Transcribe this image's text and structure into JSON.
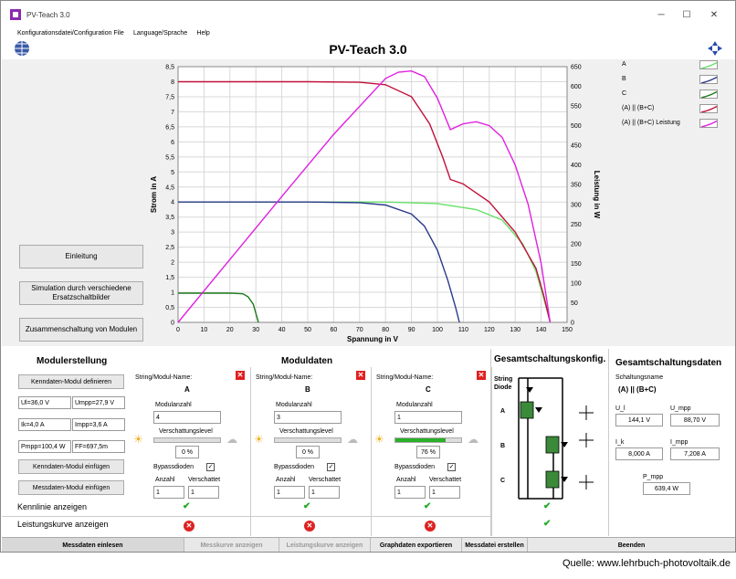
{
  "window": {
    "title": "PV-Teach 3.0",
    "min": "─",
    "max": "☐",
    "close": "✕"
  },
  "menu": [
    "Konfigurationsdatei/Configuration File",
    "Language/Sprache",
    "Help"
  ],
  "app_title": "PV-Teach 3.0",
  "left_buttons": [
    "Einleitung",
    "Simulation durch verschiedene Ersatzschaltbilder",
    "Zusammenschaltung von Modulen"
  ],
  "chart_data": {
    "type": "line",
    "xlabel": "Spannung in V",
    "ylabel": "Strom in A",
    "y2label": "Leistung in W",
    "xticks": [
      0,
      10,
      20,
      30,
      40,
      50,
      60,
      70,
      80,
      90,
      100,
      110,
      120,
      130,
      140,
      150
    ],
    "yticks": [
      "0",
      "0,5",
      "1",
      "1,5",
      "2",
      "2,5",
      "3",
      "3,5",
      "4",
      "4,5",
      "5",
      "5,5",
      "6",
      "6,5",
      "7",
      "7,5",
      "8",
      "8,5"
    ],
    "y2ticks": [
      0,
      50,
      100,
      150,
      200,
      250,
      300,
      350,
      400,
      450,
      500,
      550,
      600,
      650
    ],
    "xlim": [
      0,
      150
    ],
    "ylim": [
      0,
      8.5
    ],
    "y2lim": [
      0,
      650
    ],
    "series": [
      {
        "name": "A",
        "axis": "left",
        "color": "#66e066",
        "x": [
          0,
          40,
          80,
          100,
          115,
          125,
          133,
          138,
          141,
          143.5
        ],
        "y": [
          4,
          4,
          4,
          3.95,
          3.75,
          3.4,
          2.6,
          1.7,
          0.8,
          0
        ]
      },
      {
        "name": "B",
        "axis": "left",
        "color": "#2a3a8a",
        "x": [
          0,
          50,
          70,
          80,
          90,
          95,
          100,
          104,
          107,
          108.5
        ],
        "y": [
          4,
          4,
          3.98,
          3.9,
          3.6,
          3.2,
          2.4,
          1.4,
          0.5,
          0
        ]
      },
      {
        "name": "C",
        "axis": "left",
        "color": "#1a7a1a",
        "x": [
          0,
          20,
          25,
          27,
          29,
          30,
          31
        ],
        "y": [
          0.97,
          0.97,
          0.95,
          0.85,
          0.6,
          0.3,
          0
        ]
      },
      {
        "name": "(A) || (B+C)",
        "axis": "left",
        "color": "#c0103a",
        "x": [
          0,
          50,
          70,
          80,
          90,
          97,
          102,
          105,
          110,
          120,
          130,
          138,
          141,
          143.5
        ],
        "y": [
          8,
          8,
          7.98,
          7.9,
          7.5,
          6.6,
          5.5,
          4.75,
          4.6,
          4,
          3,
          1.8,
          0.9,
          0
        ]
      },
      {
        "name": "(A) || (B+C)  Leistung",
        "axis": "right",
        "color": "#e020e0",
        "x": [
          0,
          20,
          40,
          60,
          80,
          85,
          90,
          95,
          100,
          105,
          110,
          115,
          120,
          125,
          130,
          135,
          140,
          143.5
        ],
        "y": [
          0,
          160,
          320,
          478,
          620,
          636,
          639,
          625,
          570,
          490,
          505,
          510,
          500,
          470,
          400,
          300,
          150,
          0
        ]
      }
    ]
  },
  "legend": [
    {
      "label": "A",
      "color": "#66e066"
    },
    {
      "label": "B",
      "color": "#2a3a8a"
    },
    {
      "label": "C",
      "color": "#1a7a1a"
    },
    {
      "label": "(A) || (B+C)",
      "color": "#c0103a"
    },
    {
      "label": "(A) || (B+C)  Leistung",
      "color": "#e020e0"
    }
  ],
  "modulerstellung": {
    "title": "Modulerstellung",
    "btn_define": "Kenndaten-Modul definieren",
    "ul": "Ul=36,0 V",
    "umpp": "Umpp=27,9 V",
    "ik": "Ik=4,0 A",
    "impp": "Impp=3,6 A",
    "pmpp": "Pmpp=100,4 W",
    "ff": "FF=697,5m",
    "btn_insert": "Kenndaten-Modul einfügen",
    "btn_meas": "Messdaten-Modul einfügen",
    "kennlinie": "Kennlinie anzeigen",
    "leistung": "Leistungskurve anzeigen"
  },
  "moduldaten": {
    "title": "Moduldaten",
    "name_label": "String/Modul-Name:",
    "count_label": "Modulanzahl",
    "shade_label": "Verschattungslevel",
    "bypass_label": "Bypassdioden",
    "anzahl_label": "Anzahl",
    "verschattet_label": "Verschattet",
    "modules": [
      {
        "name": "A",
        "count": "4",
        "shade": "0 %",
        "shade_val": 0,
        "anzahl": "1",
        "versch": "1"
      },
      {
        "name": "B",
        "count": "3",
        "shade": "0 %",
        "shade_val": 0,
        "anzahl": "1",
        "versch": "1"
      },
      {
        "name": "C",
        "count": "1",
        "shade": "76 %",
        "shade_val": 0.76,
        "anzahl": "1",
        "versch": "1"
      }
    ]
  },
  "gesamtkonfig": {
    "title": "Gesamtschaltungskonfig.",
    "string_label": "String",
    "diode_label": "Diode",
    "labels": [
      "A",
      "B",
      "C"
    ]
  },
  "gesamtdaten": {
    "title": "Gesamtschaltungsdaten",
    "name_label": "Schaltungsname",
    "name": "(A) || (B+C)",
    "ul_label": "U_l",
    "ul": "144,1 V",
    "umpp_label": "U_mpp",
    "umpp": "88,70 V",
    "ik_label": "I_k",
    "ik": "8,000 A",
    "impp_label": "I_mpp",
    "impp": "7,208 A",
    "pmpp_label": "P_mpp",
    "pmpp": "639,4 W"
  },
  "bottom_buttons": [
    "Messdaten einlesen",
    "Messkurve anzeigen",
    "Leistungskurve anzeigen",
    "Graphdaten exportieren",
    "Messdatei erstellen",
    "Beenden"
  ],
  "source": "Quelle: www.lehrbuch-photovoltaik.de"
}
